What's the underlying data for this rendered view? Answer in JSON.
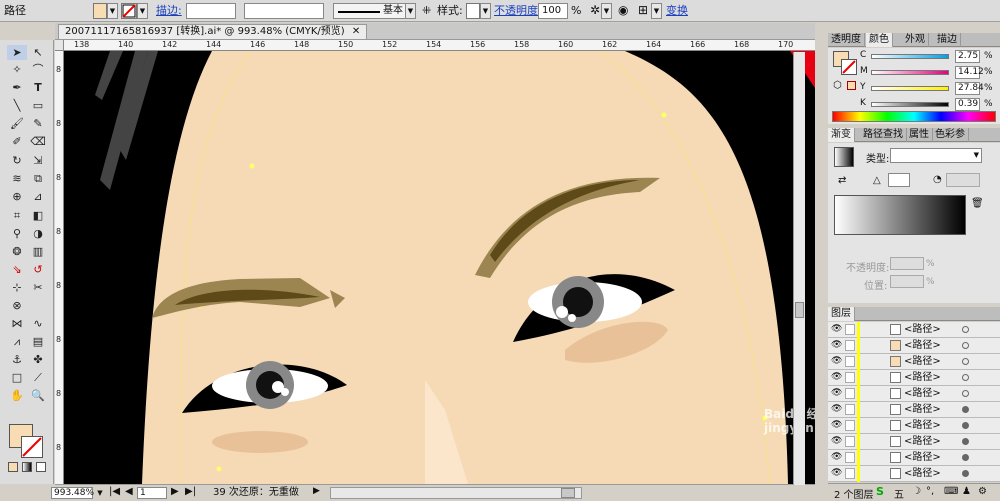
{
  "control_bar": {
    "object_type": "路径",
    "stroke_label": "描边:",
    "stroke_profile": "基本",
    "style_label": "样式:",
    "opacity_label": "不透明度",
    "opacity_value": "100",
    "opacity_unit": "%",
    "transform_label": "变换"
  },
  "document": {
    "tab_title": "20071117165816937 [转换].ai* @ 993.48% (CMYK/预览)",
    "zoom": "993.48%",
    "page": "1",
    "status_text": "39 次还原：无重做"
  },
  "ruler": {
    "h_ticks": [
      "138",
      "140",
      "142",
      "144",
      "146",
      "148",
      "150",
      "152",
      "154",
      "156",
      "158",
      "160",
      "162",
      "164",
      "166",
      "168",
      "170"
    ],
    "v_ticks": [
      "8",
      "8",
      "8",
      "8",
      "8",
      "8",
      "8",
      "8"
    ]
  },
  "color_panel": {
    "tabs": [
      "透明度",
      "颜色",
      "外观",
      "描边"
    ],
    "channels": [
      {
        "name": "C",
        "value": "2.75",
        "color": "#00a0e9"
      },
      {
        "name": "M",
        "value": "14.12",
        "color": "#e4007f"
      },
      {
        "name": "Y",
        "value": "27.84",
        "color": "#fff100"
      },
      {
        "name": "K",
        "value": "0.39",
        "color": "#000000"
      }
    ],
    "unit": "%",
    "fill_color": "#f7dcb4"
  },
  "gradient_panel": {
    "tabs": [
      "渐变",
      "路径查找",
      "属性",
      "色彩参"
    ],
    "type_label": "类型:",
    "opacity_label": "不透明度:",
    "position_label": "位置:",
    "unit": "%"
  },
  "layers_panel": {
    "title": "图层",
    "rows": [
      "<路径>",
      "<路径>",
      "<路径>",
      "<路径>",
      "<路径>",
      "<路径>",
      "<路径>",
      "<路径>",
      "<路径>",
      "<路径>"
    ],
    "footer": "2 个图层"
  },
  "taskbar": {
    "ime": "五"
  },
  "watermark": "Baidu 经验 jingyan.baidu.com"
}
